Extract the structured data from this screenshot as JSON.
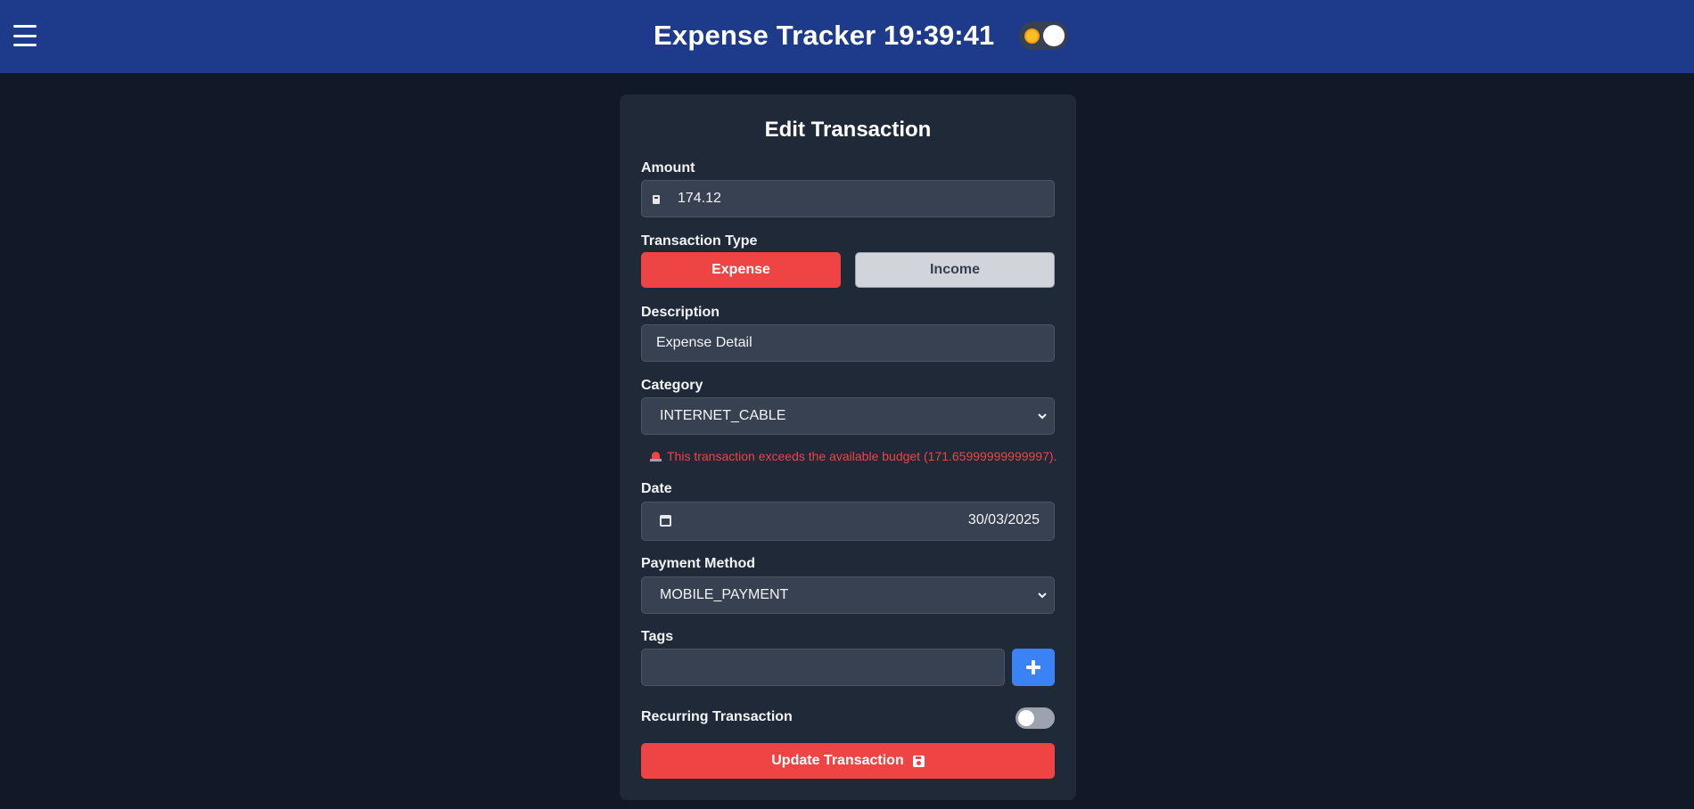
{
  "header": {
    "title": "Expense Tracker",
    "clock": "19:39:41",
    "menu_icon": "hamburger-menu-icon",
    "theme_toggle_icon": "sun-icon",
    "theme_mode": "dark"
  },
  "form": {
    "title": "Edit Transaction",
    "amount": {
      "label": "Amount",
      "value": "174.12",
      "icon": "calculator-icon"
    },
    "transaction_type": {
      "label": "Transaction Type",
      "options": [
        "Expense",
        "Income"
      ],
      "selected": "Expense"
    },
    "description": {
      "label": "Description",
      "value": "Expense Detail"
    },
    "category": {
      "label": "Category",
      "value": "INTERNET_CABLE"
    },
    "budget_warning": "This transaction exceeds the available budget (171.65999999999997).",
    "date": {
      "label": "Date",
      "value": "30/03/2025",
      "icon": "calendar-icon"
    },
    "payment_method": {
      "label": "Payment Method",
      "value": "MOBILE_PAYMENT"
    },
    "tags": {
      "label": "Tags",
      "value": "",
      "add_icon": "plus-icon"
    },
    "recurring": {
      "label": "Recurring Transaction",
      "enabled": false
    },
    "submit": {
      "label": "Update Transaction",
      "icon": "save-icon"
    }
  },
  "colors": {
    "header_bg": "#1e3a8a",
    "page_bg": "#111827",
    "card_bg": "#1f2937",
    "field_bg": "#374151",
    "expense_red": "#ef4444",
    "income_gray": "#d1d5db",
    "add_blue": "#3b82f6"
  }
}
